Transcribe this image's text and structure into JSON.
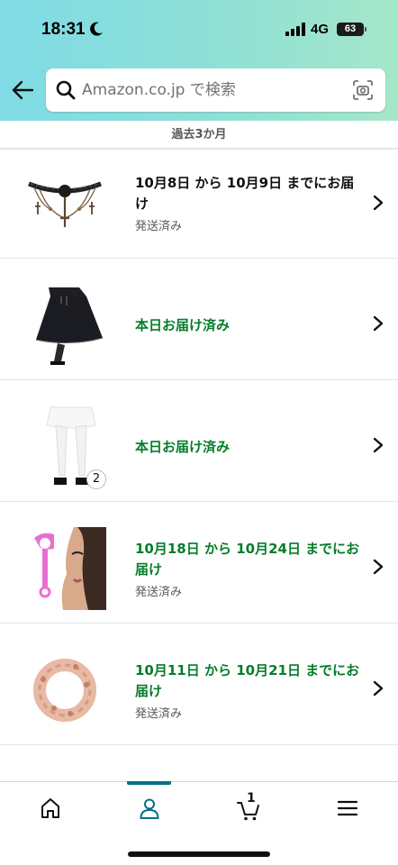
{
  "status_bar": {
    "time": "18:31",
    "network": "4G",
    "battery": "63"
  },
  "search": {
    "placeholder": "Amazon.co.jp で検索"
  },
  "section": {
    "label": "過去3か月"
  },
  "orders": [
    {
      "delivery": "10月8日 から 10月9日 までにお届け",
      "status": "発送済み",
      "color": "#0f1111",
      "image": "lace-choker-necklace"
    },
    {
      "delivery": "本日お届け済み",
      "status": "",
      "color": "#067d2a",
      "image": "black-skirt"
    },
    {
      "delivery": "本日お届け済み",
      "status": "",
      "color": "#067d2a",
      "image": "white-stockings",
      "item_count": "2"
    },
    {
      "delivery": "10月18日 から 10月24日 までにお届け",
      "status": "発送済み",
      "color": "#067d2a",
      "image": "eyelash-curler"
    },
    {
      "delivery": "10月11日 から 10月21日 までにお届け",
      "status": "発送済み",
      "color": "#067d2a",
      "image": "hair-scrunchie"
    }
  ],
  "tabbar": {
    "items": [
      "home-icon",
      "account-icon",
      "cart-icon",
      "menu-icon"
    ],
    "active": "account",
    "cart_count": "1",
    "accent": "#007185"
  }
}
